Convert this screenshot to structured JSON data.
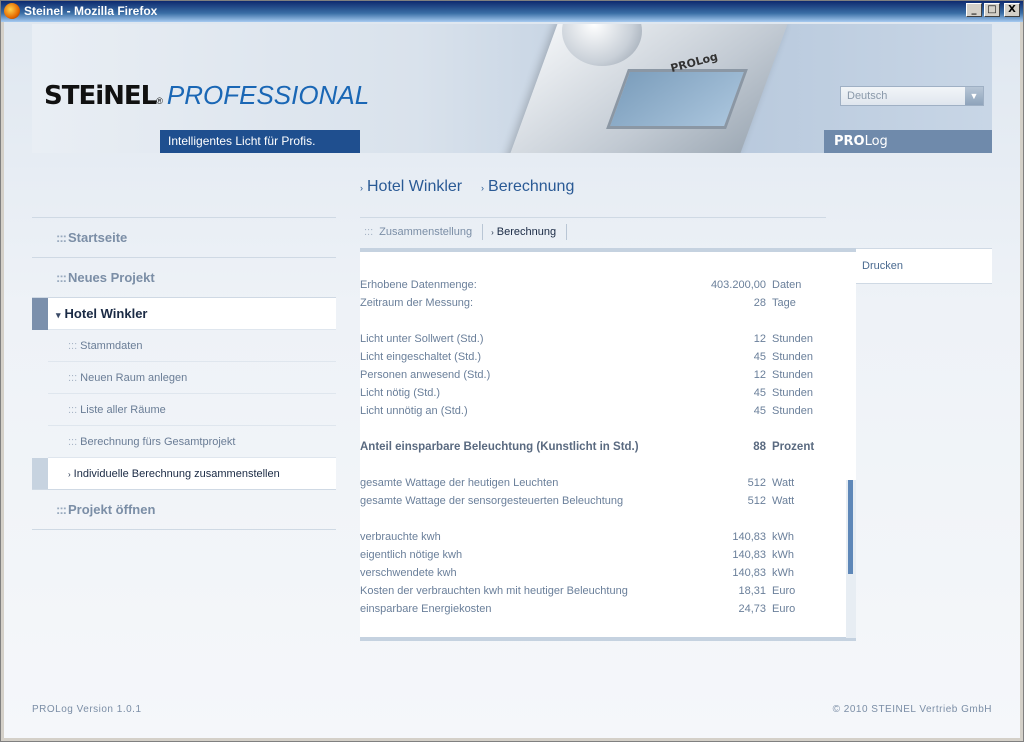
{
  "window": {
    "title": "Steinel - Mozilla Firefox",
    "controls": {
      "minimize": "_",
      "maximize": "□",
      "close": "X"
    }
  },
  "header": {
    "logo_brand": "STEiNEL",
    "logo_suffix": "PROFESSIONAL",
    "tagline": "Intelligentes Licht für Profis.",
    "device_label": "PROLog",
    "language_select": {
      "value": "Deutsch"
    },
    "product_bar": {
      "bold": "PRO",
      "rest": "Log"
    }
  },
  "breadcrumb": [
    {
      "label": "Hotel Winkler"
    },
    {
      "label": "Berechnung"
    }
  ],
  "sidebar": {
    "items": [
      {
        "label": "Startseite",
        "type": "main"
      },
      {
        "label": "Neues Projekt",
        "type": "main"
      },
      {
        "label": "Hotel Winkler",
        "type": "active"
      },
      {
        "label": "Stammdaten",
        "type": "sub"
      },
      {
        "label": "Neuen Raum anlegen",
        "type": "sub"
      },
      {
        "label": "Liste aller Räume",
        "type": "sub"
      },
      {
        "label": "Berechnung fürs Gesamtprojekt",
        "type": "sub"
      },
      {
        "label": "Individuelle Berechnung zusammenstellen",
        "type": "current"
      },
      {
        "label": "Projekt öffnen",
        "type": "main"
      }
    ]
  },
  "tabs": [
    {
      "label": "Zusammenstellung",
      "active": false
    },
    {
      "label": "Berechnung",
      "active": true
    }
  ],
  "tools": {
    "print_label": "Drucken"
  },
  "results": {
    "g1": [
      {
        "label": "Erhobene Datenmenge:",
        "value": "403.200,00",
        "unit": "Daten"
      },
      {
        "label": "Zeitraum der Messung:",
        "value": "28",
        "unit": "Tage"
      }
    ],
    "g2": [
      {
        "label": "Licht unter Sollwert (Std.)",
        "value": "12",
        "unit": "Stunden"
      },
      {
        "label": "Licht eingeschaltet (Std.)",
        "value": "45",
        "unit": "Stunden"
      },
      {
        "label": "Personen anwesend (Std.)",
        "value": "12",
        "unit": "Stunden"
      },
      {
        "label": "Licht nötig (Std.)",
        "value": "45",
        "unit": "Stunden"
      },
      {
        "label": "Licht unnötig an (Std.)",
        "value": "45",
        "unit": "Stunden"
      }
    ],
    "highlight": {
      "label": "Anteil einsparbare Beleuchtung (Kunstlicht in Std.)",
      "value": "88",
      "unit": "Prozent"
    },
    "g3": [
      {
        "label": "gesamte Wattage der heutigen Leuchten",
        "value": "512",
        "unit": "Watt"
      },
      {
        "label": "gesamte Wattage der sensorgesteuerten Beleuchtung",
        "value": "512",
        "unit": "Watt"
      }
    ],
    "g4": [
      {
        "label": "verbrauchte kwh",
        "value": "140,83",
        "unit": "kWh"
      },
      {
        "label": "eigentlich nötige kwh",
        "value": "140,83",
        "unit": "kWh"
      },
      {
        "label": "verschwendete kwh",
        "value": "140,83",
        "unit": "kWh"
      },
      {
        "label": "Kosten der verbrauchten kwh mit heutiger Beleuchtung",
        "value": "18,31",
        "unit": "Euro"
      },
      {
        "label": "einsparbare Energiekosten",
        "value": "24,73",
        "unit": "Euro"
      }
    ]
  },
  "footer": {
    "version": "PROLog Version 1.0.1",
    "copyright": "© 2010 STEINEL Vertrieb GmbH"
  },
  "colors": {
    "accent_blue": "#1f4f8f",
    "brand_blue": "#1a67b5",
    "product_bar": "#6f8aab"
  }
}
